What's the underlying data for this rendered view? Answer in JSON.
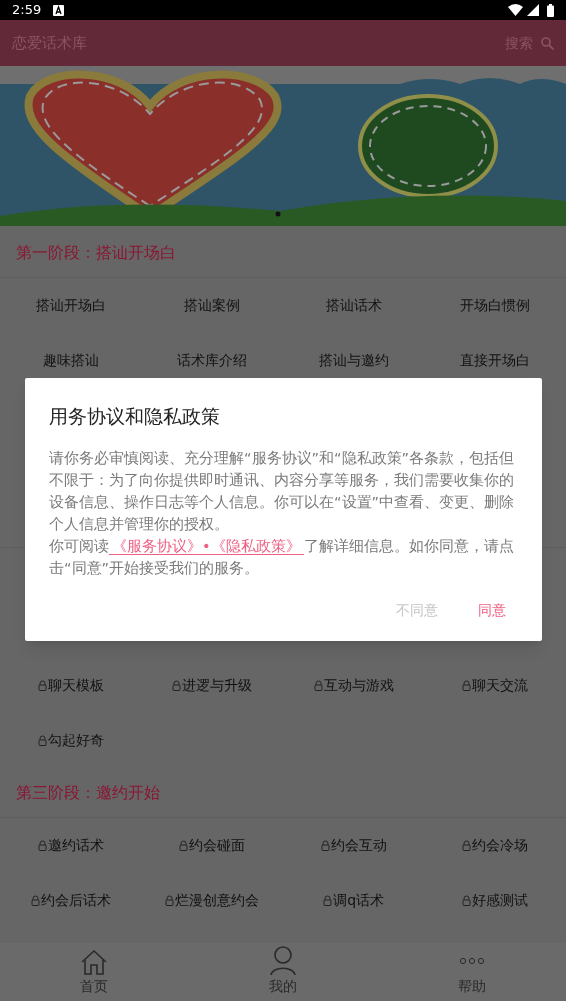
{
  "status_bar": {
    "time": "2:59"
  },
  "app_bar": {
    "title": "恋爱话术库",
    "search_label": "搜索"
  },
  "sections": [
    {
      "title": "第一阶段：搭讪开场白",
      "items": [
        {
          "label": "搭讪开场白",
          "locked": false
        },
        {
          "label": "搭讪案例",
          "locked": false
        },
        {
          "label": "搭讪话术",
          "locked": false
        },
        {
          "label": "开场白惯例",
          "locked": false
        },
        {
          "label": "趣味搭讪",
          "locked": false
        },
        {
          "label": "话术库介绍",
          "locked": false
        },
        {
          "label": "搭讪与邀约",
          "locked": false
        },
        {
          "label": "直接开场白",
          "locked": false
        }
      ]
    },
    {
      "items": [
        {
          "label": "聊天模板",
          "locked": true
        },
        {
          "label": "进逻与升级",
          "locked": true
        },
        {
          "label": "互动与游戏",
          "locked": true
        },
        {
          "label": "聊天交流",
          "locked": true
        },
        {
          "label": "勾起好奇",
          "locked": true
        }
      ]
    },
    {
      "title": "第三阶段：邀约开始",
      "items": [
        {
          "label": "邀约话术",
          "locked": true
        },
        {
          "label": "约会碰面",
          "locked": true
        },
        {
          "label": "约会互动",
          "locked": true
        },
        {
          "label": "约会冷场",
          "locked": true
        },
        {
          "label": "约会后话术",
          "locked": true
        },
        {
          "label": "烂漫创意约会",
          "locked": true
        },
        {
          "label": "调q话术",
          "locked": true
        },
        {
          "label": "好感测试",
          "locked": true
        }
      ]
    }
  ],
  "bottom_nav": [
    {
      "kind": "home",
      "label": "首页"
    },
    {
      "kind": "profile",
      "label": "我的"
    },
    {
      "kind": "more",
      "label": "帮助"
    }
  ],
  "dialog": {
    "title": "用务协议和隐私政策",
    "paragraph": "请你务必审慎阅读、充分理解“服务协议”和“隐私政策”各条款，包括但不限于：为了向你提供即时通讯、内容分享等服务，我们需要收集你的设备信息、操作日志等个人信息。你可以在“设置”中查看、变更、删除个人信息并管理你的授权。",
    "read_prefix": "你可阅读",
    "link": "《服务协议》•《隐私政策》",
    "read_suffix": "了解详细信息。如你同意，请点击“同意”开始接受我们的服务。",
    "buttons": [
      {
        "kind": "decline",
        "label": "不同意"
      },
      {
        "kind": "accept",
        "label": "同意"
      }
    ]
  }
}
